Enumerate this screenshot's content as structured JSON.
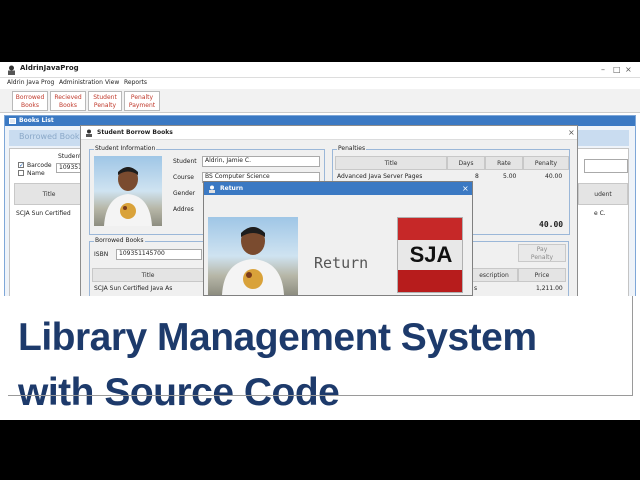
{
  "window": {
    "title": "AldrinJavaProg"
  },
  "menu": [
    "Aldrin Java Prog",
    "Administration",
    "View",
    "Reports"
  ],
  "toolbar": [
    {
      "line1": "Borrowed",
      "line2": "Books"
    },
    {
      "line1": "Recieved",
      "line2": "Books"
    },
    {
      "line1": "Student",
      "line2": "Penalty"
    },
    {
      "line1": "Penalty",
      "line2": "Payment"
    }
  ],
  "books_list": {
    "title": "Books List",
    "header": "Borrowed Book",
    "student_label": "Student",
    "barcode_label": "Barcode",
    "name_label": "Name",
    "student_id": "10935114",
    "col_title": "Title",
    "col_student": "udent",
    "row_title": "SCJA Sun Certified",
    "row_student": "e C."
  },
  "borrow_dialog": {
    "title": "Student Borrow Books",
    "student_info": {
      "legend": "Student Information",
      "student_label": "Student",
      "student_value": "Aldrin, Jamie C.",
      "course_label": "Course",
      "course_value": "BS Computer Science",
      "gender_label": "Gender",
      "address_label": "Addres"
    },
    "penalties": {
      "legend": "Penalties",
      "cols": [
        "Title",
        "Days",
        "Rate",
        "Penalty"
      ],
      "row": [
        "Advanced Java Server Pages",
        "8",
        "5.00",
        "40.00"
      ],
      "total": "40.00",
      "pay_button_line1": "Pay",
      "pay_button_line2": "Penalty"
    },
    "borrowed": {
      "legend": "Borrowed Books",
      "isbn_label": "ISBN",
      "isbn_value": "109351145700",
      "col_title": "Title",
      "col_description": "escription",
      "col_price": "Price",
      "row_title": "SCJA Sun Certified Java As",
      "row_description": "s",
      "row_price": "1,211.00"
    }
  },
  "return_dialog": {
    "title": "Return",
    "return_text": "Return",
    "book_cover_text": "SJA"
  },
  "banner": {
    "line1": "Library Management System",
    "line2": "with Source Code"
  },
  "colors": {
    "banner_text": "#1d3a6b",
    "title_bar_blue": "#3b79c3",
    "toolbar_text": "#c0392b"
  }
}
